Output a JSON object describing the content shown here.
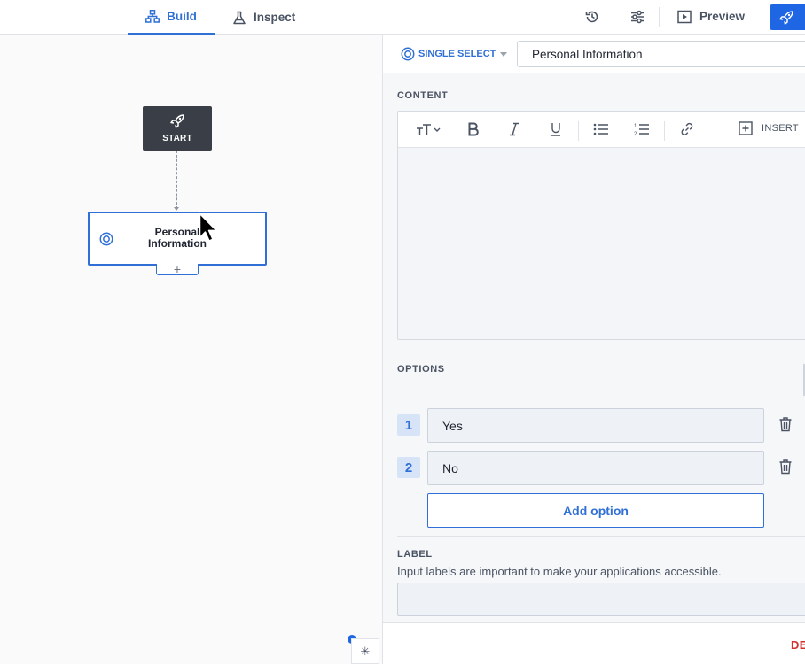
{
  "topbar": {
    "tabs": [
      {
        "label": "Build",
        "icon": "flow-icon",
        "active": true
      },
      {
        "label": "Inspect",
        "icon": "flask-icon",
        "active": false
      }
    ],
    "icons": [
      "history-icon",
      "sliders-icon"
    ],
    "preview_label": "Preview",
    "publish_icon": "rocket-icon",
    "accent": "#1f66e5"
  },
  "canvas": {
    "start_label": "START",
    "step_title": "Personal Information",
    "add_symbol": "+",
    "mini_button_symbol": "✳"
  },
  "panel": {
    "type_label": "SINGLE SELECT",
    "title_value": "Personal Information",
    "content_label": "CONTENT",
    "insert_label": "INSERT",
    "options_label": "OPTIONS",
    "options": [
      {
        "num": "1",
        "value": "Yes"
      },
      {
        "num": "2",
        "value": "No"
      }
    ],
    "add_option_label": "Add option",
    "label_section": "LABEL",
    "label_help": "Input labels are important to make your applications accessible.",
    "label_value": "",
    "delete_label": "DE"
  }
}
